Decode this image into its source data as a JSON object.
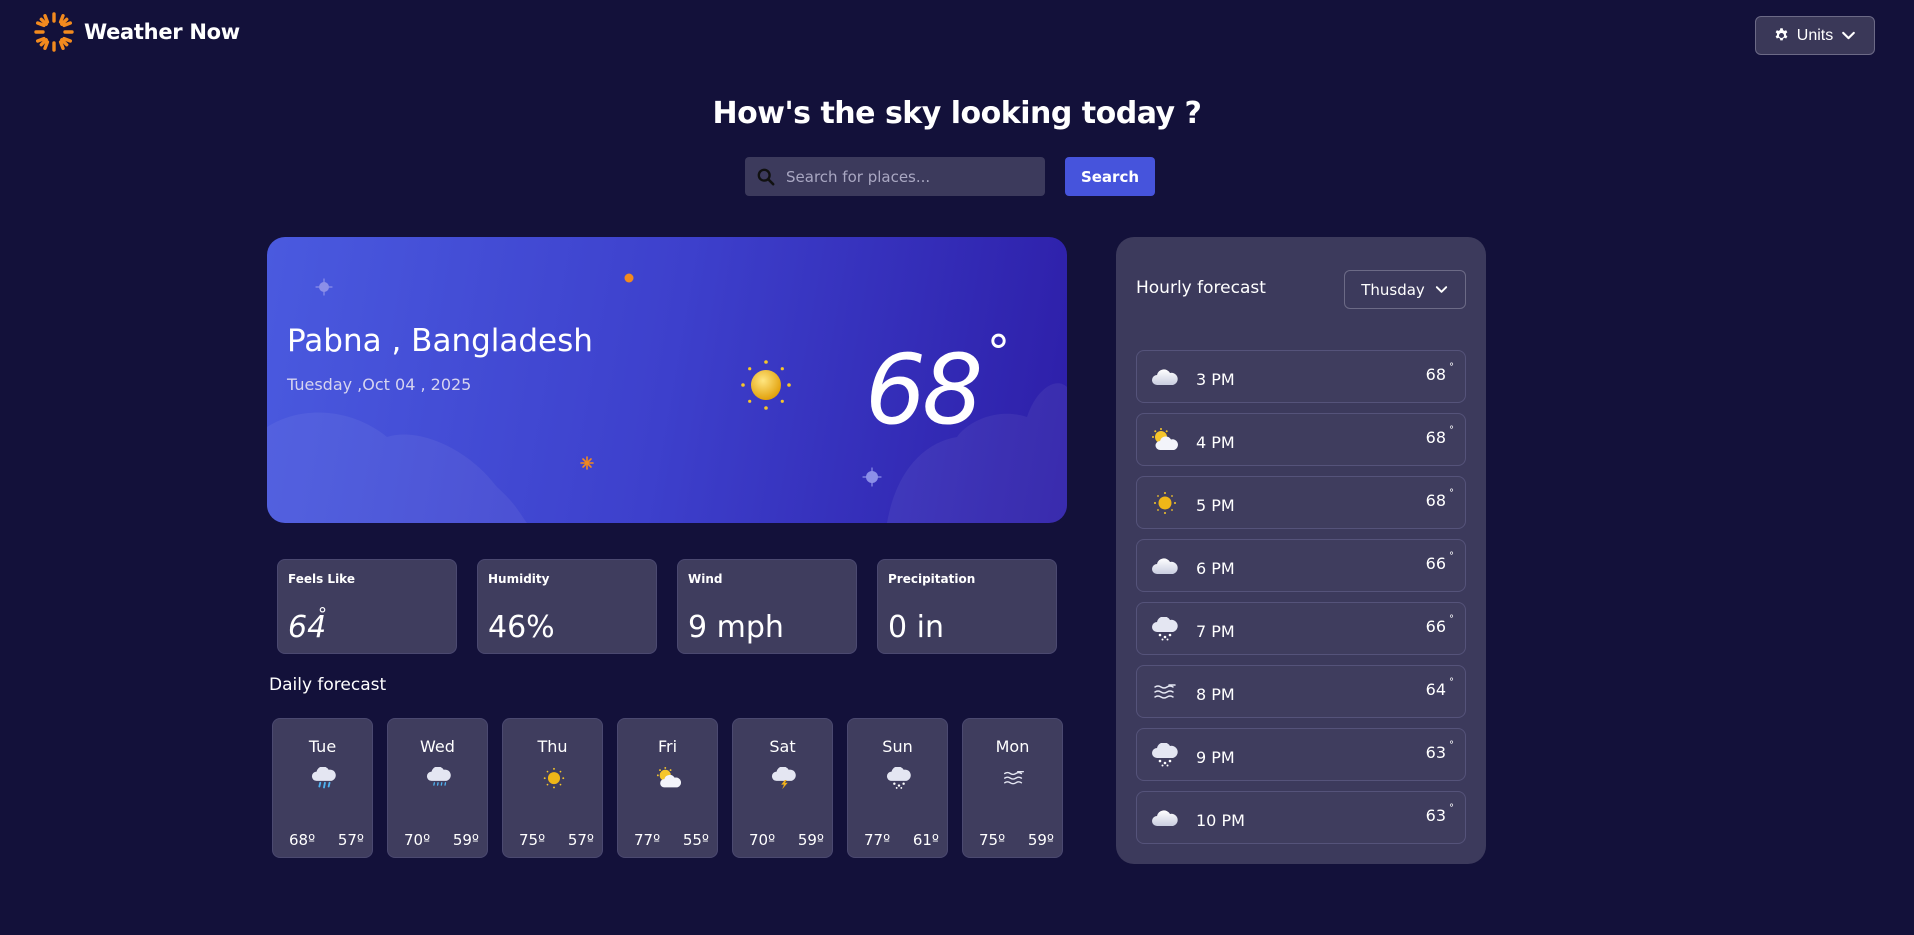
{
  "header": {
    "app_name": "Weather Now",
    "units_label": "Units"
  },
  "hero": {
    "headline": "How's the sky looking today ?",
    "search_placeholder": "Search for places...",
    "search_button": "Search"
  },
  "current": {
    "location": "Pabna , Bangladesh",
    "date": "Tuesday ,Oct 04 , 2025",
    "temperature": "68",
    "degree_symbol": "°",
    "icon": "sunny-icon"
  },
  "stats": [
    {
      "label": "Feels Like",
      "value": "64",
      "unit": "°"
    },
    {
      "label": "Humidity",
      "value": "46%"
    },
    {
      "label": "Wind",
      "value": "9 mph"
    },
    {
      "label": "Precipitation",
      "value": "0 in"
    }
  ],
  "daily": {
    "title": "Daily forecast",
    "days": [
      {
        "day": "Tue",
        "icon": "rain-icon",
        "high": "68º",
        "low": "57º"
      },
      {
        "day": "Wed",
        "icon": "drizzle-icon",
        "high": "70º",
        "low": "59º"
      },
      {
        "day": "Thu",
        "icon": "sunny-icon",
        "high": "75º",
        "low": "57º"
      },
      {
        "day": "Fri",
        "icon": "partly-cloudy-icon",
        "high": "77º",
        "low": "55º"
      },
      {
        "day": "Sat",
        "icon": "storm-icon",
        "high": "70º",
        "low": "59º"
      },
      {
        "day": "Sun",
        "icon": "snow-icon",
        "high": "77º",
        "low": "61º"
      },
      {
        "day": "Mon",
        "icon": "fog-icon",
        "high": "75º",
        "low": "59º"
      }
    ]
  },
  "hourly": {
    "title": "Hourly forecast",
    "selected_day": "Thusday",
    "hours": [
      {
        "time": "3 PM",
        "temp": "68",
        "icon": "cloud-icon"
      },
      {
        "time": "4 PM",
        "temp": "68",
        "icon": "partly-cloudy-icon"
      },
      {
        "time": "5 PM",
        "temp": "68",
        "icon": "sunny-icon"
      },
      {
        "time": "6 PM",
        "temp": "66",
        "icon": "cloud-icon"
      },
      {
        "time": "7 PM",
        "temp": "66",
        "icon": "snow-icon"
      },
      {
        "time": "8 PM",
        "temp": "64",
        "icon": "fog-icon"
      },
      {
        "time": "9 PM",
        "temp": "63",
        "icon": "snow-icon"
      },
      {
        "time": "10 PM",
        "temp": "63",
        "icon": "cloud-icon"
      }
    ],
    "degree_symbol": "°"
  },
  "colors": {
    "background": "#13113a",
    "card": "#3f3d5e",
    "accent": "#4654dc",
    "logo": "#f28a1e"
  }
}
